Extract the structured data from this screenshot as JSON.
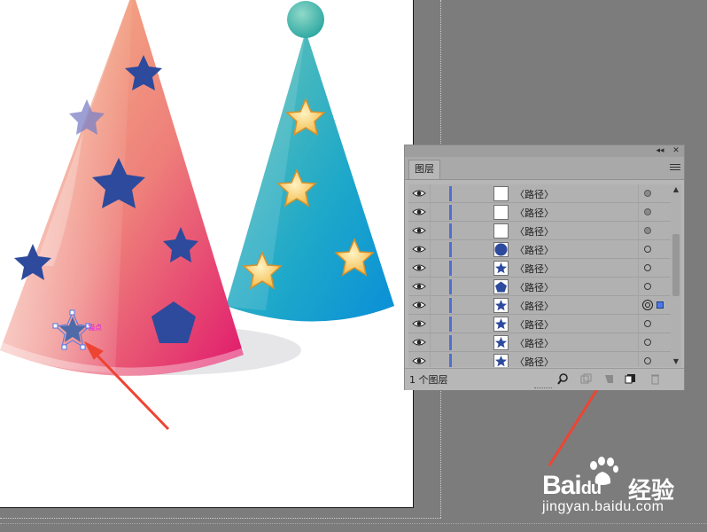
{
  "panel": {
    "tab_label": "图层",
    "collapse_glyph": "◂◂",
    "close_glyph": "✕",
    "layer_count": "1 个图层",
    "rows": [
      {
        "label": "〈路径〉",
        "thumb": "blank",
        "target": "filled"
      },
      {
        "label": "〈路径〉",
        "thumb": "blank",
        "target": "filled"
      },
      {
        "label": "〈路径〉",
        "thumb": "blank",
        "target": "filled"
      },
      {
        "label": "〈路径〉",
        "thumb": "circle",
        "target": "hollow"
      },
      {
        "label": "〈路径〉",
        "thumb": "star",
        "target": "hollow"
      },
      {
        "label": "〈路径〉",
        "thumb": "pentagon",
        "target": "hollow"
      },
      {
        "label": "〈路径〉",
        "thumb": "star",
        "target": "selected"
      },
      {
        "label": "〈路径〉",
        "thumb": "star",
        "target": "hollow"
      },
      {
        "label": "〈路径〉",
        "thumb": "star",
        "target": "hollow"
      },
      {
        "label": "〈路径〉",
        "thumb": "star",
        "target": "hollow"
      }
    ],
    "bottom_icons": [
      "locate-object-icon",
      "make-clipping-mask-icon",
      "create-sublayer-icon",
      "new-layer-icon",
      "delete-icon"
    ]
  },
  "watermark": {
    "brand": "Bai",
    "brand_suffix": "du",
    "cn": "经验",
    "url": "jingyan.baidu.com"
  },
  "colors": {
    "selection_blue": "#4d79e6",
    "star_navy": "#2d4a9c",
    "arrow_red": "#ee4433"
  }
}
